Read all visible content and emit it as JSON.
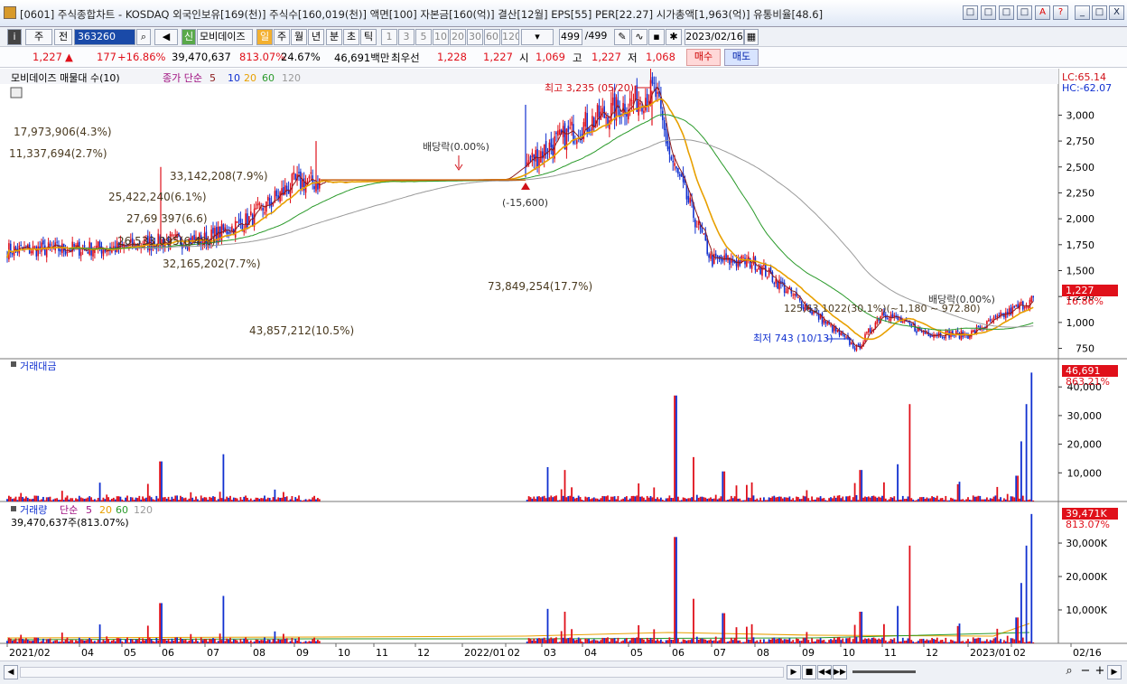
{
  "title": "[0601] 주식종합차트 - KOSDAQ 외국인보유[169(천)] 주식수[160,019(천)] 액면[100] 자본금[160(억)] 결산[12월] EPS[55] PER[22.27] 시가총액[1,963(억)] 유통비율[48.6]",
  "window_buttons": [
    "□",
    "□",
    "□",
    "□",
    "A",
    "?",
    "_",
    "□",
    "X"
  ],
  "toolbar": {
    "market": "주",
    "full": "전",
    "code": "363260",
    "name": "모비데이즈",
    "period_selected": "일",
    "periods": [
      "일",
      "주",
      "월",
      "년",
      "분",
      "초",
      "틱"
    ],
    "intervals": [
      "1",
      "3",
      "5",
      "10",
      "20",
      "30",
      "60",
      "120"
    ],
    "count": "499",
    "count_total": "/499",
    "date": "2023/02/16",
    "new_badge": "신"
  },
  "pricebar": {
    "price": "1,227",
    "change": "177",
    "change_pct": "+16.86%",
    "volume": "39,470,637",
    "volume_pct": "813.07%",
    "turnover": "24.67%",
    "amount": "46,691백만",
    "best_label": "최우선",
    "ask": "1,228",
    "bid": "1,227",
    "open_label": "시",
    "open": "1,069",
    "high_label": "고",
    "high": "1,227",
    "low_label": "저",
    "low": "1,068",
    "buy": "매수",
    "sell": "매도"
  },
  "price_panel": {
    "legend_name": "모비데이즈 매물대 수(10)",
    "legend_ma": "종가 단순",
    "ma_periods": [
      "5",
      "10",
      "20",
      "60",
      "120"
    ],
    "lc_label": "LC:65.14",
    "hc_label": "HC:-62.07",
    "price_tag": "1,227",
    "pct_tag": "16.86%",
    "high_note": "최고 3,235 (05/20)",
    "low_note": "최저 743 (10/13)",
    "dividend_note": "배당락(0.00%)",
    "dividend_note2": "배당락(0.00%)",
    "gap_note": "(-15,600)",
    "range_note": "125,63 1022(30.1%)(~1,180 ~ 972.80)",
    "y_ticks": [
      "3,000",
      "2,750",
      "2,500",
      "2,250",
      "2,000",
      "1,750",
      "1,500",
      "1,250",
      "1,000",
      "750"
    ],
    "profile": [
      "17,973,906(4.3%)",
      "11,337,694(2.7%)",
      "33,142,208(7.9%)",
      "25,422,240(6.1%)",
      "27,69 397(6.6)",
      "26,533,095(6.4%)",
      "32,165,202(7.7%)",
      "73,849,254(17.7%)",
      "43,857,212(10.5%)"
    ]
  },
  "amount_panel": {
    "legend": "거래대금",
    "tag": "46,691",
    "tag_pct": "863.21%",
    "y_ticks": [
      "40,000",
      "30,000",
      "20,000",
      "10,000"
    ]
  },
  "volume_panel": {
    "legend": "거래량",
    "legend_ma": "단순",
    "ma_periods": [
      "5",
      "20",
      "60",
      "120"
    ],
    "value_note": "39,470,637주(813.07%)",
    "tag": "39,471K",
    "tag_pct": "813.07%",
    "y_ticks": [
      "30,000K",
      "20,000K",
      "10,000K"
    ]
  },
  "x_labels": [
    "2021/02",
    "04",
    "05",
    "06",
    "07",
    "08",
    "09",
    "10",
    "11",
    "12",
    "2022/01",
    "02",
    "03",
    "04",
    "05",
    "06",
    "07",
    "08",
    "09",
    "10",
    "11",
    "12",
    "2023/01",
    "02",
    "02/16"
  ],
  "colors": {
    "up": "#e0101a",
    "down": "#1030d0",
    "ma5": "#8b1a1a",
    "ma20": "#e8a000",
    "ma60": "#2a9a2a",
    "ma120": "#9a9a9a",
    "profile": "#f6e4cc"
  },
  "chart_data": {
    "type": "candlestick",
    "x_range": [
      "2021/02",
      "2023/02/16"
    ],
    "y_range": [
      650,
      3300
    ],
    "key_points": [
      {
        "date": "2021/02",
        "close": 1700
      },
      {
        "date": "2021/05",
        "close": 1720
      },
      {
        "date": "2021/06",
        "close": 1780
      },
      {
        "date": "2021/07",
        "close": 1800
      },
      {
        "date": "2021/08",
        "close": 2000
      },
      {
        "date": "2021/09",
        "close": 2350
      },
      {
        "date": "2022/02",
        "close": 2380
      },
      {
        "date": "2022/03",
        "close": 2650
      },
      {
        "date": "2022/04",
        "close": 2900
      },
      {
        "date": "2022/05/20",
        "close": 3235
      },
      {
        "date": "2022/06",
        "close": 2600
      },
      {
        "date": "2022/07",
        "close": 1600
      },
      {
        "date": "2022/08",
        "close": 1580
      },
      {
        "date": "2022/09",
        "close": 1200
      },
      {
        "date": "2022/10/13",
        "close": 743
      },
      {
        "date": "2022/11",
        "close": 1100
      },
      {
        "date": "2022/12",
        "close": 900
      },
      {
        "date": "2023/01",
        "close": 880
      },
      {
        "date": "2023/02/16",
        "close": 1227
      }
    ],
    "amount_max": 46691,
    "volume_max_k": 39471
  }
}
